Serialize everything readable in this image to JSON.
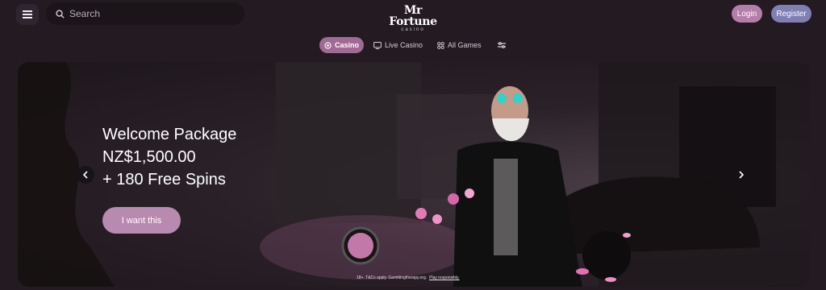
{
  "header": {
    "search_placeholder": "Search",
    "logo_text": "Mr Fortune",
    "logo_subtext": "casino",
    "login_label": "Login",
    "register_label": "Register"
  },
  "nav": {
    "tabs": [
      {
        "label": "Casino",
        "icon": "casino-chip-icon",
        "active": true
      },
      {
        "label": "Live Casino",
        "icon": "live-tv-icon",
        "active": false
      },
      {
        "label": "All Games",
        "icon": "grid-icon",
        "active": false
      }
    ],
    "filter_icon": "sliders-icon"
  },
  "hero": {
    "title_line1": "Welcome Package",
    "title_line2": "NZ$1,500.00",
    "title_line3": "+ 180 Free Spins",
    "cta_label": "I want this",
    "legal_text": "18+. T&Cs apply. Gamblingtherapy.org.",
    "legal_link": "Play responsibly."
  },
  "colors": {
    "background": "#231a22",
    "login": "#b57ea8",
    "register": "#7f7fb3",
    "active_tab": "#a06a95",
    "cta": "#b98aaf"
  }
}
